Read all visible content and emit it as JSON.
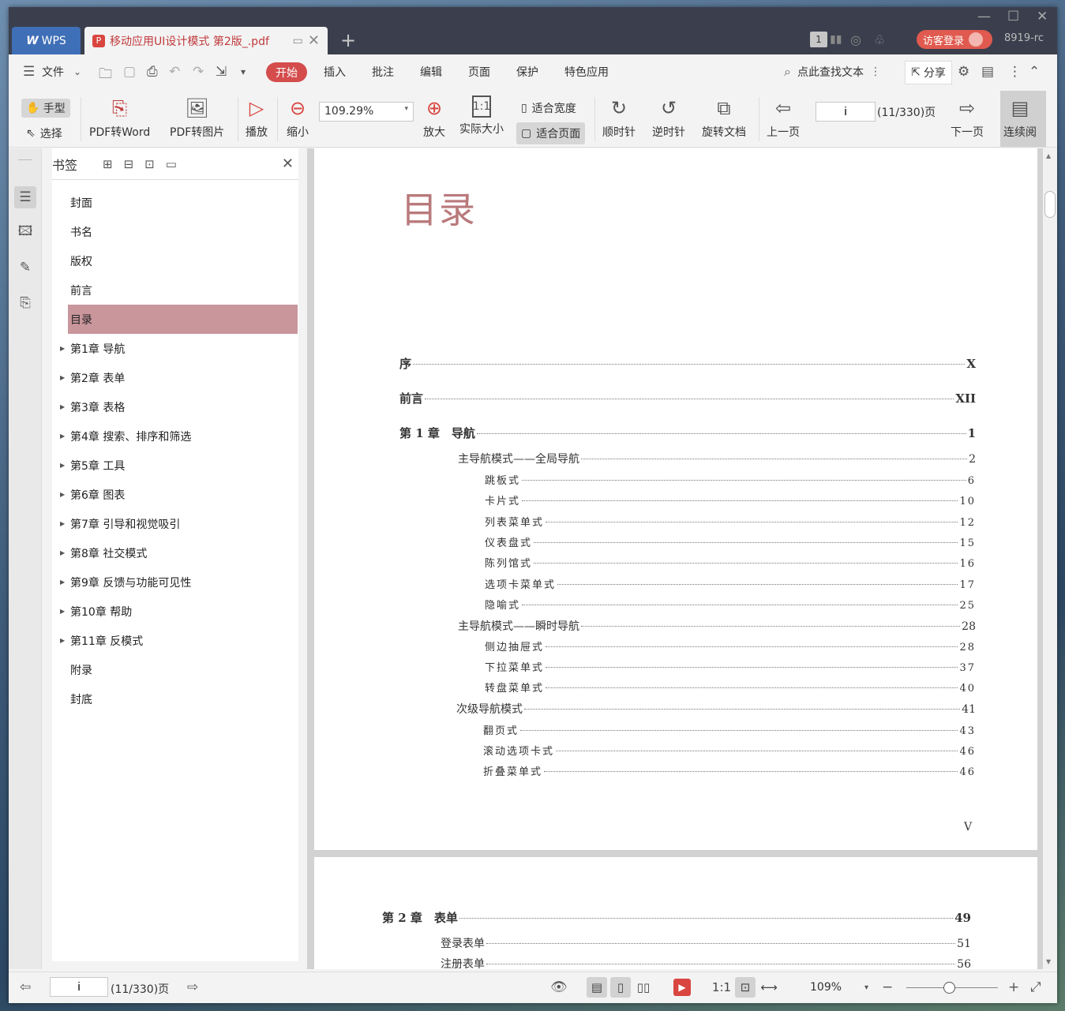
{
  "titlebar": {
    "app_tab": "WPS",
    "doc_tab": "移动应用UI设计模式 第2版_.pdf",
    "page_badge": "1",
    "login": "访客登录",
    "user": "8919-rc"
  },
  "menubar": {
    "file": "文件",
    "items": [
      "开始",
      "插入",
      "批注",
      "编辑",
      "页面",
      "保护",
      "特色应用"
    ],
    "search": "点此查找文本",
    "share": "分享"
  },
  "toolbar": {
    "hand": "手型",
    "select": "选择",
    "pdf_word": "PDF转Word",
    "pdf_image": "PDF转图片",
    "play": "播放",
    "zoom_out": "缩小",
    "zoom_value": "109.29%",
    "zoom_in": "放大",
    "actual_size": "实际大小",
    "fit_width": "适合宽度",
    "fit_page": "适合页面",
    "rotate_cw": "顺时针",
    "rotate_ccw": "逆时针",
    "rotate_doc": "旋转文档",
    "prev_page": "上一页",
    "page_input": "i",
    "page_count": "(11/330)页",
    "next_page": "下一页",
    "continuous": "连续阅"
  },
  "bookmarks": {
    "title": "书签",
    "items": [
      {
        "label": "封面",
        "expandable": false
      },
      {
        "label": "书名",
        "expandable": false
      },
      {
        "label": "版权",
        "expandable": false
      },
      {
        "label": "前言",
        "expandable": false
      },
      {
        "label": "目录",
        "expandable": false,
        "selected": true
      },
      {
        "label": "第1章  导航",
        "expandable": true
      },
      {
        "label": "第2章  表单",
        "expandable": true
      },
      {
        "label": "第3章  表格",
        "expandable": true
      },
      {
        "label": "第4章  搜索、排序和筛选",
        "expandable": true
      },
      {
        "label": "第5章  工具",
        "expandable": true
      },
      {
        "label": "第6章  图表",
        "expandable": true
      },
      {
        "label": "第7章  引导和视觉吸引",
        "expandable": true
      },
      {
        "label": "第8章  社交模式",
        "expandable": true
      },
      {
        "label": "第9章  反馈与功能可见性",
        "expandable": true
      },
      {
        "label": "第10章  帮助",
        "expandable": true
      },
      {
        "label": "第11章  反模式",
        "expandable": true
      },
      {
        "label": "附录",
        "expandable": false
      },
      {
        "label": "封底",
        "expandable": false
      }
    ]
  },
  "document": {
    "page1": {
      "title": "目录",
      "entries": [
        {
          "level": 1,
          "label": "序",
          "page": "X"
        },
        {
          "level": 1,
          "label": "前言",
          "page": "XII"
        },
        {
          "level": 1,
          "label": "第 1 章　导航",
          "page": "1"
        },
        {
          "level": 2,
          "label": "主导航模式——全局导航",
          "page": "2"
        },
        {
          "level": 3,
          "label": "跳板式",
          "page": "6"
        },
        {
          "level": 3,
          "label": "卡片式",
          "page": "10"
        },
        {
          "level": 3,
          "label": "列表菜单式",
          "page": "12"
        },
        {
          "level": 3,
          "label": "仪表盘式",
          "page": "15"
        },
        {
          "level": 3,
          "label": "陈列馆式",
          "page": "16"
        },
        {
          "level": 3,
          "label": "选项卡菜单式",
          "page": "17"
        },
        {
          "level": 3,
          "label": "隐喻式",
          "page": "25"
        },
        {
          "level": 2,
          "label": "主导航模式——瞬时导航",
          "page": "28"
        },
        {
          "level": 3,
          "label": "侧边抽屉式",
          "page": "28"
        },
        {
          "level": 3,
          "label": "下拉菜单式",
          "page": "37"
        },
        {
          "level": 3,
          "label": "转盘菜单式",
          "page": "40"
        },
        {
          "level": 2,
          "label": "次级导航模式",
          "page": "41"
        },
        {
          "level": 3,
          "label": "翻页式",
          "page": "43"
        },
        {
          "level": 3,
          "label": "滚动选项卡式",
          "page": "46"
        },
        {
          "level": 3,
          "label": "折叠菜单式",
          "page": "46"
        }
      ],
      "page_number": "V"
    },
    "page2": {
      "entries": [
        {
          "level": 1,
          "label": "第 2 章　表单",
          "page": "49"
        },
        {
          "level": 2,
          "label": "登录表单",
          "page": "51"
        },
        {
          "level": 2,
          "label": "注册表单",
          "page": "56"
        }
      ]
    }
  },
  "statusbar": {
    "page_input": "i",
    "page_count": "(11/330)页",
    "zoom": "109%"
  }
}
